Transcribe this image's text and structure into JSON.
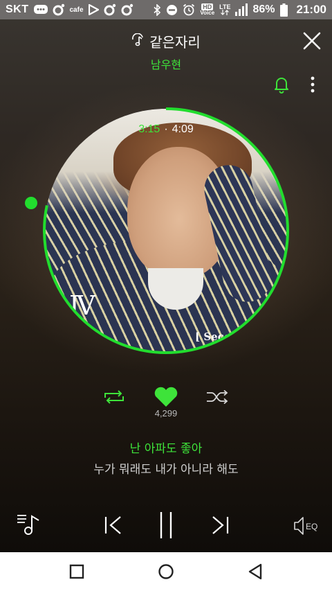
{
  "status_bar": {
    "carrier": "SKT",
    "cafe_label": "cafe",
    "hd_label": "HD",
    "voice_label": "Voice",
    "lte_label": "LTE",
    "battery": "86%",
    "time": "21:00"
  },
  "header": {
    "song_title": "같은자리",
    "artist": "남우현"
  },
  "album": {
    "cover_text_numeral": "Ⅳ",
    "cover_text_title": "[ Secon"
  },
  "playback": {
    "current_time": "3:15",
    "separator": "·",
    "total_time": "4:09",
    "progress_fraction": 0.783
  },
  "actions": {
    "like_count": "4,299"
  },
  "lyrics": {
    "current_line": "난 아파도 좋아",
    "next_line": "누가 뭐래도 내가 아니라 해도"
  },
  "controls": {
    "eq_label": "EQ"
  },
  "colors": {
    "accent": "#3ee33a",
    "status_bar": "#6e6b6a",
    "nav_bar": "#ffffff"
  },
  "icons": {
    "title_icon": "music-note-icon",
    "close": "close-icon",
    "bell": "bell-icon",
    "more": "more-vertical-icon",
    "repeat": "repeat-icon",
    "like": "heart-icon",
    "shuffle": "shuffle-icon",
    "playlist": "playlist-icon",
    "prev": "skip-previous-icon",
    "pause": "pause-icon",
    "next": "skip-next-icon",
    "eq": "equalizer-icon"
  }
}
